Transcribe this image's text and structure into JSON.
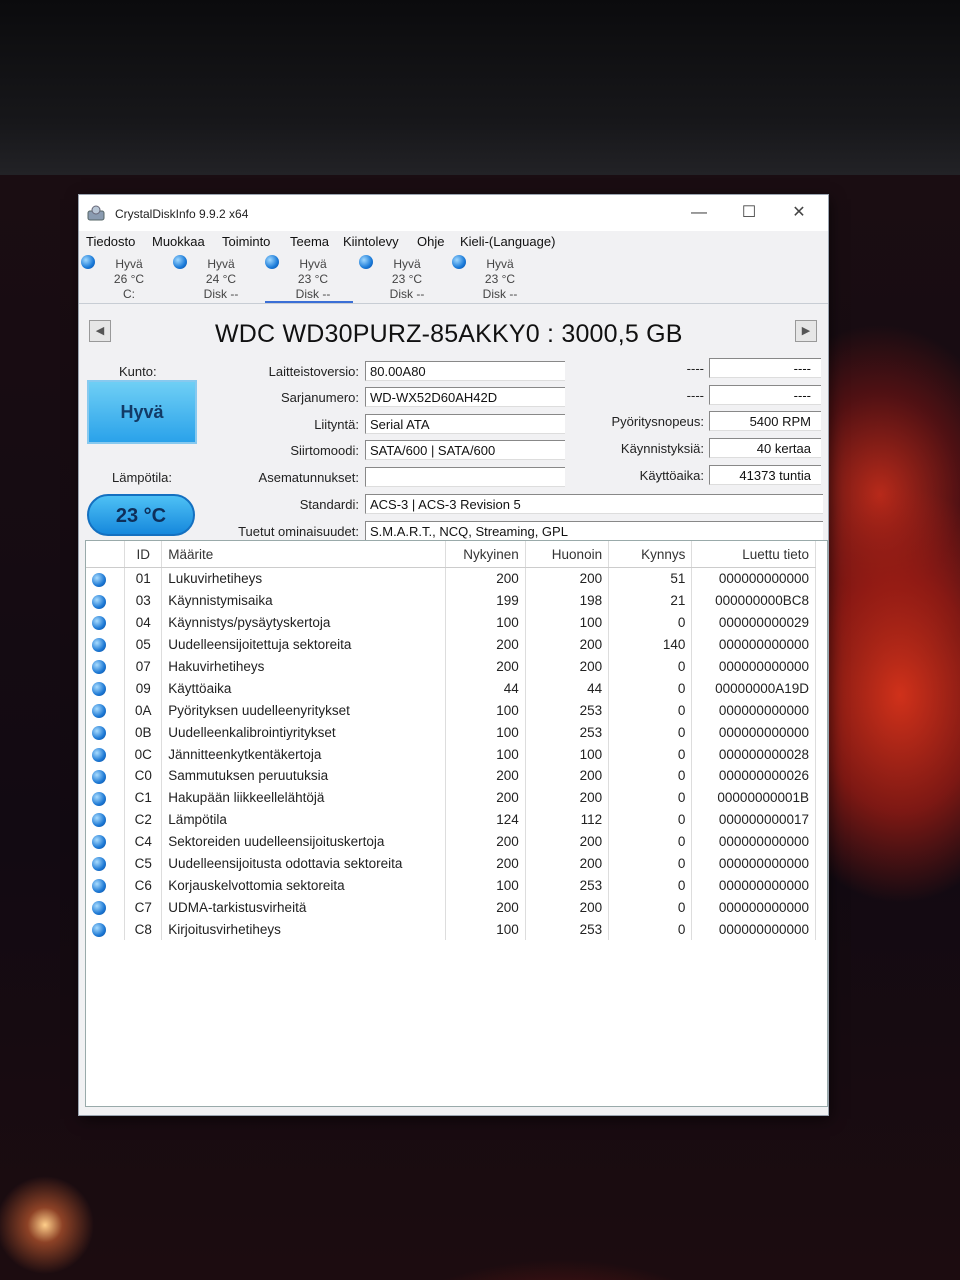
{
  "app": {
    "title": "CrystalDiskInfo 9.9.2 x64",
    "minimize": "—",
    "maximize": "☐",
    "close": "✕"
  },
  "menu": [
    "Tiedosto",
    "Muokkaa",
    "Toiminto",
    "Teema",
    "Kiintolevy",
    "Ohje",
    "Kieli-(Language)"
  ],
  "disks": [
    {
      "status": "Hyvä",
      "temp": "26 °C",
      "name": "C:"
    },
    {
      "status": "Hyvä",
      "temp": "24 °C",
      "name": "Disk --"
    },
    {
      "status": "Hyvä",
      "temp": "23 °C",
      "name": "Disk --"
    },
    {
      "status": "Hyvä",
      "temp": "23 °C",
      "name": "Disk --"
    },
    {
      "status": "Hyvä",
      "temp": "23 °C",
      "name": "Disk --"
    }
  ],
  "drive": {
    "model": "WDC WD30PURZ-85AKKY0 : 3000,5 GB",
    "health_label": "Kunto:",
    "health": "Hyvä",
    "temp_label": "Lämpötila:",
    "temp": "23 °C",
    "fields": [
      {
        "label": "Laitteistoversio:",
        "value": "80.00A80"
      },
      {
        "label": "Sarjanumero:",
        "value": "WD-WX52D60AH42D"
      },
      {
        "label": "Liityntä:",
        "value": "Serial ATA"
      },
      {
        "label": "Siirtomoodi:",
        "value": "SATA/600 | SATA/600"
      },
      {
        "label": "Asematunnukset:",
        "value": ""
      },
      {
        "label": "Standardi:",
        "value": "ACS-3 | ACS-3 Revision 5"
      },
      {
        "label": "Tuetut ominaisuudet:",
        "value": "S.M.A.R.T., NCQ, Streaming, GPL"
      }
    ],
    "right": [
      {
        "label": "----",
        "value": "----"
      },
      {
        "label": "----",
        "value": "----"
      },
      {
        "label": "Pyöritysnopeus:",
        "value": "5400 RPM"
      },
      {
        "label": "Käynnistyksiä:",
        "value": "40 kertaa"
      },
      {
        "label": "Käyttöaika:",
        "value": "41373 tuntia"
      }
    ]
  },
  "smart": {
    "headers": [
      "ID",
      "Määrite",
      "Nykyinen",
      "Huonoin",
      "Kynnys",
      "Luettu tieto"
    ],
    "rows": [
      [
        "01",
        "Lukuvirhetiheys",
        "200",
        "200",
        "51",
        "000000000000"
      ],
      [
        "03",
        "Käynnistymisaika",
        "199",
        "198",
        "21",
        "000000000BC8"
      ],
      [
        "04",
        "Käynnistys/pysäytyskertoja",
        "100",
        "100",
        "0",
        "000000000029"
      ],
      [
        "05",
        "Uudelleensijoitettuja sektoreita",
        "200",
        "200",
        "140",
        "000000000000"
      ],
      [
        "07",
        "Hakuvirhetiheys",
        "200",
        "200",
        "0",
        "000000000000"
      ],
      [
        "09",
        "Käyttöaika",
        "44",
        "44",
        "0",
        "00000000A19D"
      ],
      [
        "0A",
        "Pyörityksen uudelleenyritykset",
        "100",
        "253",
        "0",
        "000000000000"
      ],
      [
        "0B",
        "Uudelleenkalibrointiyritykset",
        "100",
        "253",
        "0",
        "000000000000"
      ],
      [
        "0C",
        "Jännitteenkytkentäkertoja",
        "100",
        "100",
        "0",
        "000000000028"
      ],
      [
        "C0",
        "Sammutuksen peruutuksia",
        "200",
        "200",
        "0",
        "000000000026"
      ],
      [
        "C1",
        "Hakupään liikkeellelähtöjä",
        "200",
        "200",
        "0",
        "00000000001B"
      ],
      [
        "C2",
        "Lämpötila",
        "124",
        "112",
        "0",
        "000000000017"
      ],
      [
        "C4",
        "Sektoreiden uudelleensijoituskertoja",
        "200",
        "200",
        "0",
        "000000000000"
      ],
      [
        "C5",
        "Uudelleensijoitusta odottavia sektoreita",
        "200",
        "200",
        "0",
        "000000000000"
      ],
      [
        "C6",
        "Korjauskelvottomia sektoreita",
        "100",
        "253",
        "0",
        "000000000000"
      ],
      [
        "C7",
        "UDMA-tarkistusvirheitä",
        "200",
        "200",
        "0",
        "000000000000"
      ],
      [
        "C8",
        "Kirjoitusvirhetiheys",
        "100",
        "253",
        "0",
        "000000000000"
      ]
    ]
  }
}
